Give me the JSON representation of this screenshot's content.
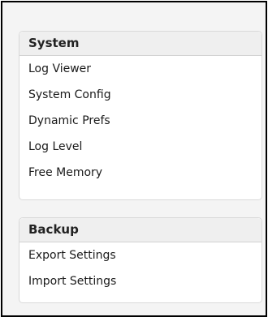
{
  "sections": [
    {
      "title": "System",
      "items": [
        {
          "label": "Log Viewer"
        },
        {
          "label": "System Config"
        },
        {
          "label": "Dynamic Prefs"
        },
        {
          "label": "Log Level"
        },
        {
          "label": "Free Memory"
        }
      ]
    },
    {
      "title": "Backup",
      "items": [
        {
          "label": "Export Settings"
        },
        {
          "label": "Import Settings"
        }
      ]
    }
  ],
  "colors": {
    "page_background": "#f4f4f4",
    "panel_background": "#ffffff",
    "panel_header_background": "#efefef",
    "panel_border": "#d9d9d9",
    "frame_border": "#000000",
    "text": "#1a1a1a"
  }
}
